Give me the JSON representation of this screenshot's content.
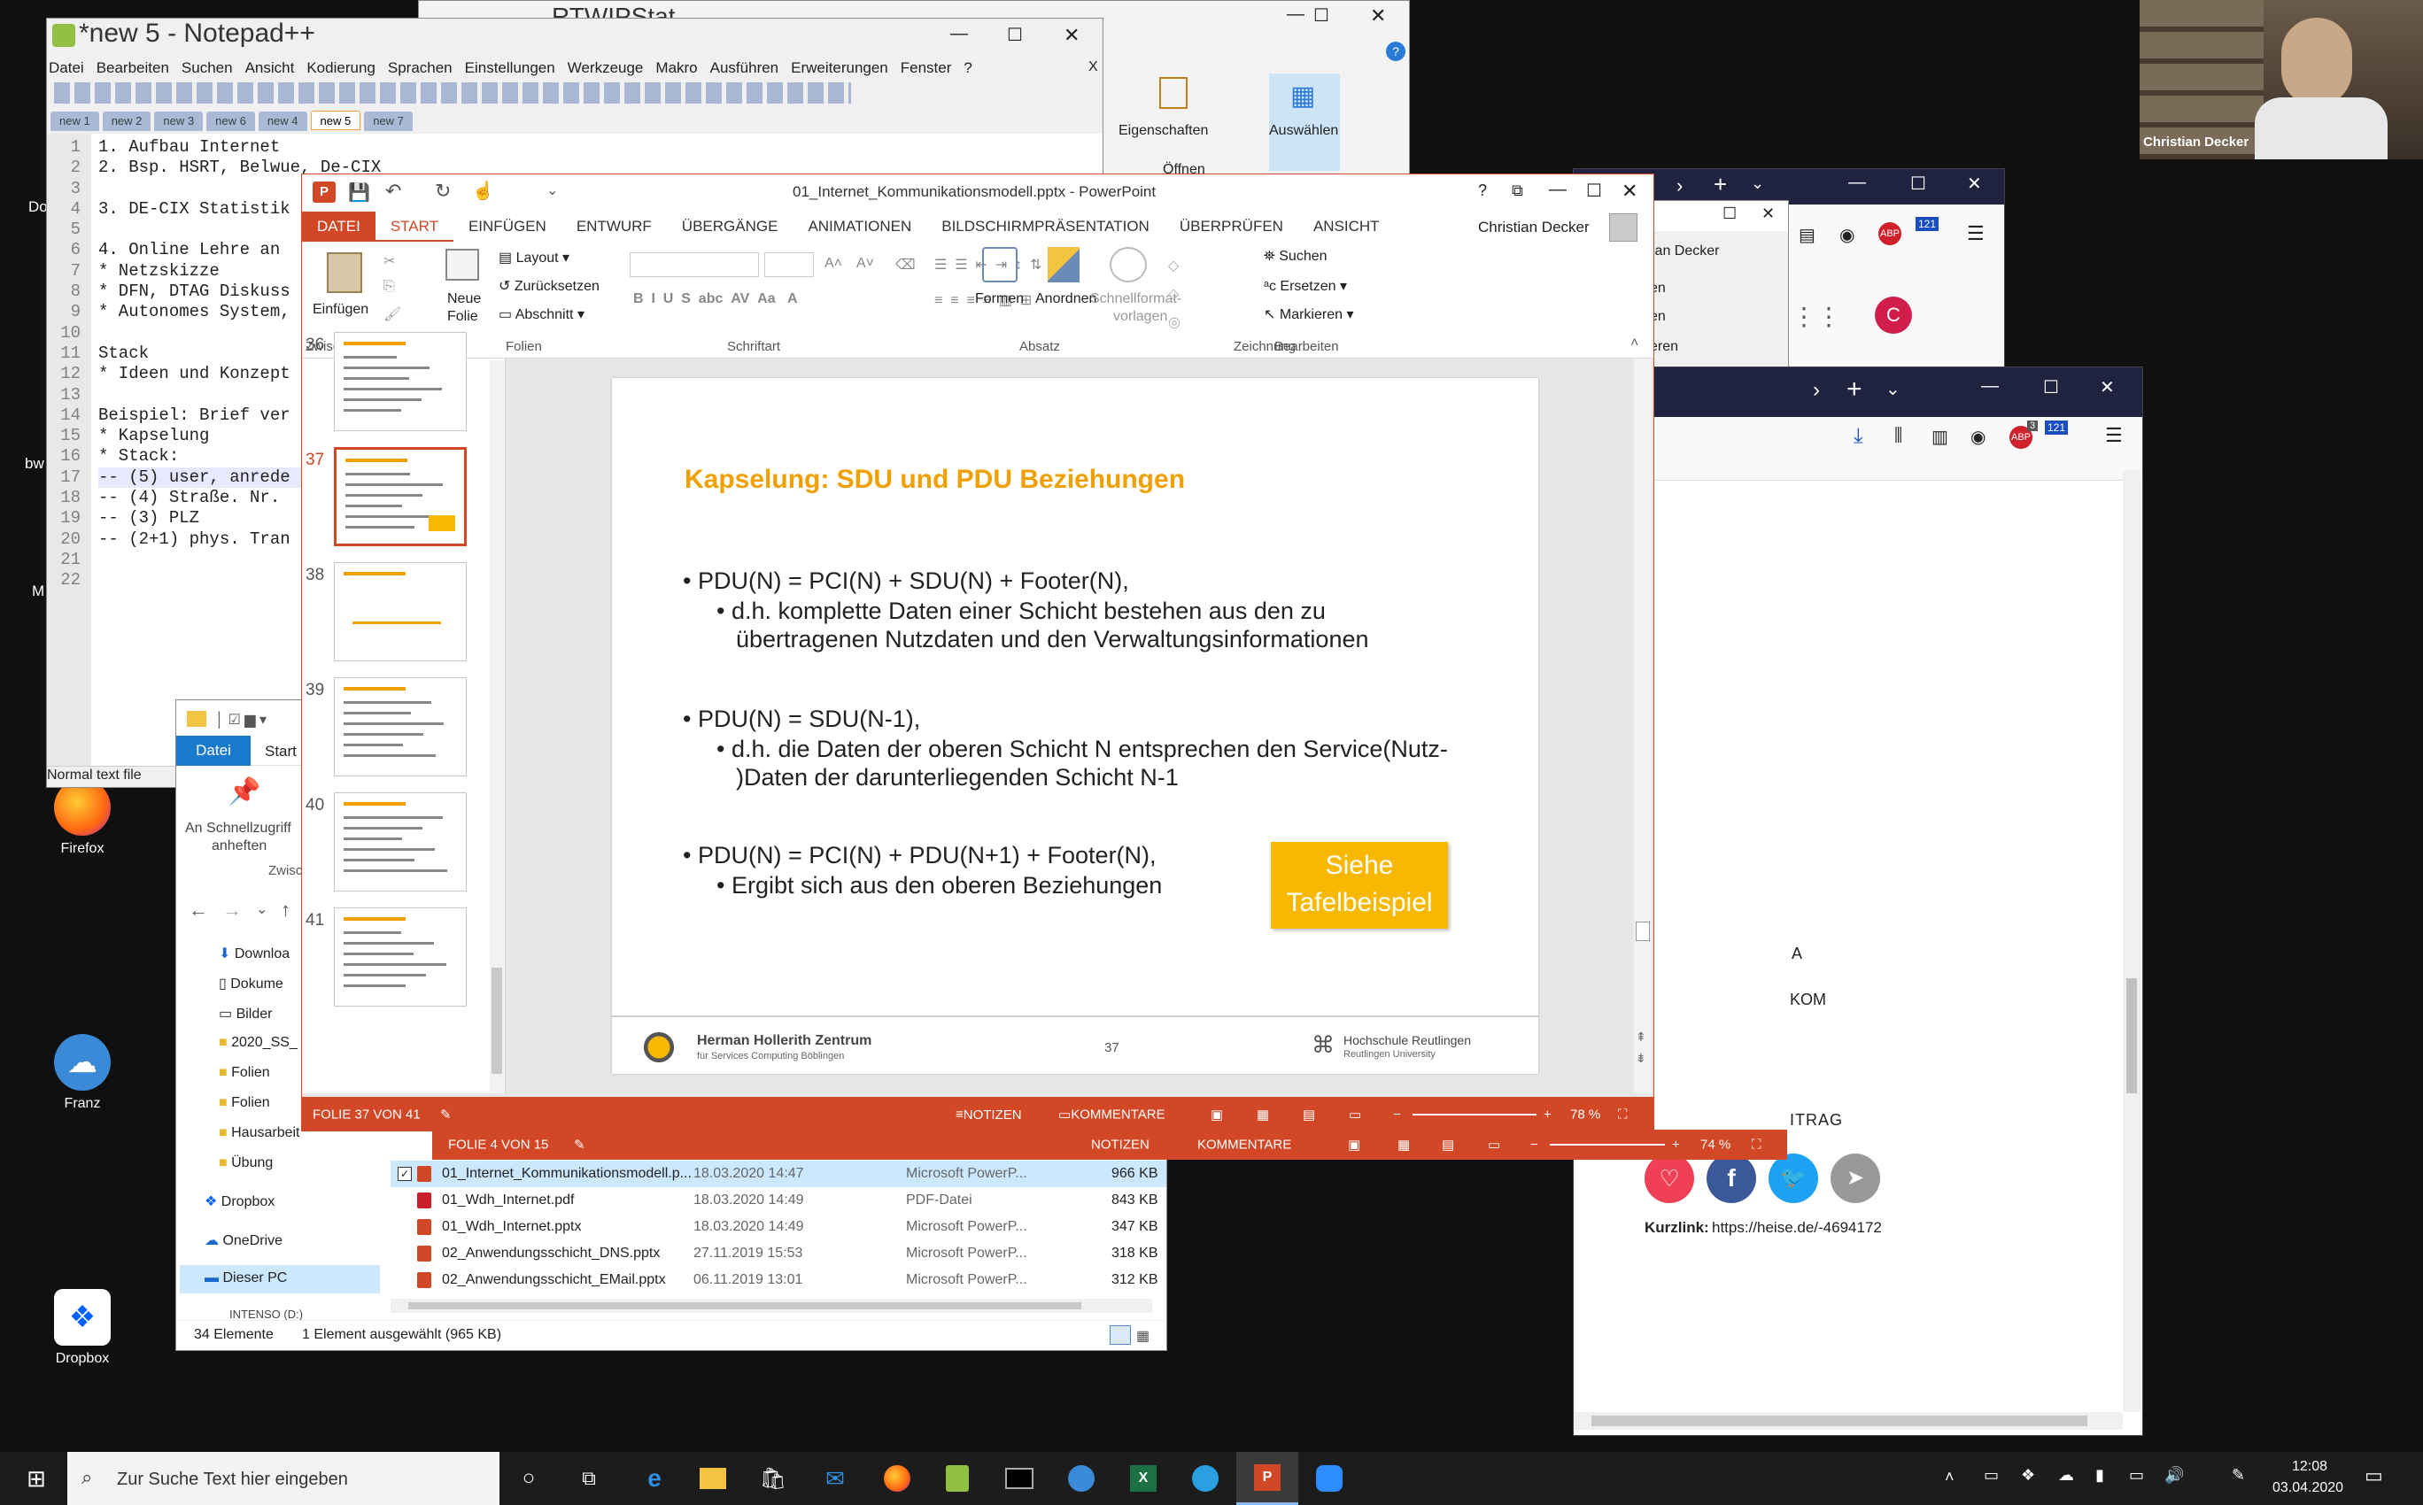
{
  "desktop": {
    "icons": [
      {
        "label": "Firefox"
      },
      {
        "label": "Franz"
      },
      {
        "label": "Dropbox"
      }
    ],
    "edge_labels": [
      "Do",
      "bw",
      "M"
    ]
  },
  "notepad": {
    "title": "*new 5 - Notepad++",
    "menu": [
      "Datei",
      "Bearbeiten",
      "Suchen",
      "Ansicht",
      "Kodierung",
      "Sprachen",
      "Einstellungen",
      "Werkzeuge",
      "Makro",
      "Ausführen",
      "Erweiterungen",
      "Fenster",
      "?"
    ],
    "close_x": "X",
    "tabs": [
      "new 1",
      "new 2",
      "new 3",
      "new 6",
      "new 4",
      "new 5",
      "new 7"
    ],
    "active_tab": "new 5",
    "lines": [
      "1. Aufbau Internet",
      "2. Bsp. HSRT, Belwue, De-CIX",
      "",
      "3. DE-CIX Statistik",
      "",
      "4. Online Lehre an",
      "* Netzskizze",
      "* DFN, DTAG Diskuss",
      "* Autonomes System,",
      "",
      "Stack",
      "* Ideen und Konzept",
      "",
      "Beispiel: Brief ver",
      "* Kapselung",
      "* Stack:",
      "-- (5) user, anrede",
      "-- (4) Straße. Nr.",
      "-- (3) PLZ",
      "-- (2+1) phys. Tran",
      "",
      ""
    ],
    "status": "Normal text file"
  },
  "rtwip": {
    "title": "RTWIPStat",
    "btn_properties": "Eigenschaften",
    "btn_open": "Öffnen",
    "btn_select": "Auswählen"
  },
  "browser_back": {
    "user_partial": "ian Decker",
    "menu_partial": [
      "en",
      "en",
      "eren",
      "len"
    ],
    "avatar_letter": "C"
  },
  "browser_front": {
    "text_a": "A",
    "text_kom": "KOM",
    "text_itrag": "ITRAG",
    "kurzlink_label": "Kurzlink:",
    "kurzlink_url": "https://heise.de/-4694172",
    "abp_badge": "121",
    "abp_count": "3"
  },
  "ppt_front": {
    "title": "01_Internet_Kommunikationsmodell.pptx - PowerPoint",
    "user": "Christian Decker",
    "tabs": [
      "DATEI",
      "START",
      "EINFÜGEN",
      "ENTWURF",
      "ÜBERGÄNGE",
      "ANIMATIONEN",
      "BILDSCHIRMPRÄSENTATION",
      "ÜBERPRÜFEN",
      "ANSICHT"
    ],
    "active_tab": "START",
    "ribbon": {
      "einfuegen": "Einfügen",
      "neue_folie_1": "Neue",
      "neue_folie_2": "Folie",
      "layout": "Layout",
      "zuruecksetzen": "Zurücksetzen",
      "abschnitt": "Abschnitt",
      "formen": "Formen",
      "anordnen": "Anordnen",
      "schnellformat_1": "Schnellformat-",
      "schnellformat_2": "vorlagen",
      "suchen": "Suchen",
      "ersetzen": "Ersetzen",
      "markieren": "Markieren",
      "groups": [
        "Zwischenablage",
        "Folien",
        "Schriftart",
        "Absatz",
        "Zeichnung",
        "Bearbeiten"
      ]
    },
    "thumbs": [
      "36",
      "37",
      "38",
      "39",
      "40",
      "41"
    ],
    "selected_thumb": "37",
    "slide": {
      "title": "Kapselung: SDU und PDU Beziehungen",
      "b1": "PDU(N) = PCI(N) + SDU(N) + Footer(N),",
      "b1s1": "d.h. komplette Daten einer Schicht bestehen aus den zu",
      "b1s2": "übertragenen Nutzdaten und den Verwaltungsinformationen",
      "b2": "PDU(N) = SDU(N-1),",
      "b2s1": "d.h. die Daten der oberen Schicht N entsprechen den Service(Nutz-",
      "b2s2": ")Daten der darunterliegenden Schicht N-1",
      "b3": "PDU(N) = PCI(N) + PDU(N+1) + Footer(N),",
      "b3s1": "Ergibt sich aus den oberen Beziehungen",
      "callout_1": "Siehe",
      "callout_2": "Tafelbeispiel",
      "footer_org_1": "Herman Hollerith Zentrum",
      "footer_org_2": "für Services Computing Böblingen",
      "page": "37",
      "uni_1": "Hochschule Reutlingen",
      "uni_2": "Reutlingen University"
    },
    "status": {
      "folie": "FOLIE 37 VON 41",
      "notizen": "NOTIZEN",
      "kommentare": "KOMMENTARE",
      "zoom": "78 %"
    }
  },
  "ppt_back": {
    "status": {
      "folie": "FOLIE 4 VON 15",
      "notizen": "NOTIZEN",
      "kommentare": "KOMMENTARE",
      "zoom": "74 %"
    }
  },
  "explorer": {
    "tab_datei": "Datei",
    "tab_start": "Start",
    "pin_1": "An Schnellzugriff",
    "pin_2": "anheften",
    "zwis": "Zwisc",
    "nav": [
      "Downloa",
      "Dokume",
      "Bilder",
      "2020_SS_",
      "Folien",
      "Folien",
      "Hausarbeit",
      "Übung",
      "Dropbox",
      "OneDrive",
      "Dieser PC",
      "INTENSO (D:)"
    ],
    "files": [
      {
        "name": "01_Internet_Kommunikationsmodell.p...",
        "date": "18.03.2020 14:47",
        "type": "Microsoft PowerP...",
        "size": "966 KB",
        "kind": "ppt"
      },
      {
        "name": "01_Wdh_Internet.pdf",
        "date": "18.03.2020 14:49",
        "type": "PDF-Datei",
        "size": "843 KB",
        "kind": "pdf"
      },
      {
        "name": "01_Wdh_Internet.pptx",
        "date": "18.03.2020 14:49",
        "type": "Microsoft PowerP...",
        "size": "347 KB",
        "kind": "ppt"
      },
      {
        "name": "02_Anwendungsschicht_DNS.pptx",
        "date": "27.11.2019 15:53",
        "type": "Microsoft PowerP...",
        "size": "318 KB",
        "kind": "ppt"
      },
      {
        "name": "02_Anwendungsschicht_EMail.pptx",
        "date": "06.11.2019 13:01",
        "type": "Microsoft PowerP...",
        "size": "312 KB",
        "kind": "ppt"
      }
    ],
    "status_count": "34 Elemente",
    "status_sel": "1 Element ausgewählt (965 KB)"
  },
  "webcam": {
    "name": "Christian Decker"
  },
  "taskbar": {
    "search_placeholder": "Zur Suche Text hier eingeben",
    "time": "12:08",
    "date": "03.04.2020"
  },
  "colors": {
    "ppt_accent": "#d24726",
    "slide_title": "#f0a000",
    "taskbar": "#1c1c1c"
  }
}
